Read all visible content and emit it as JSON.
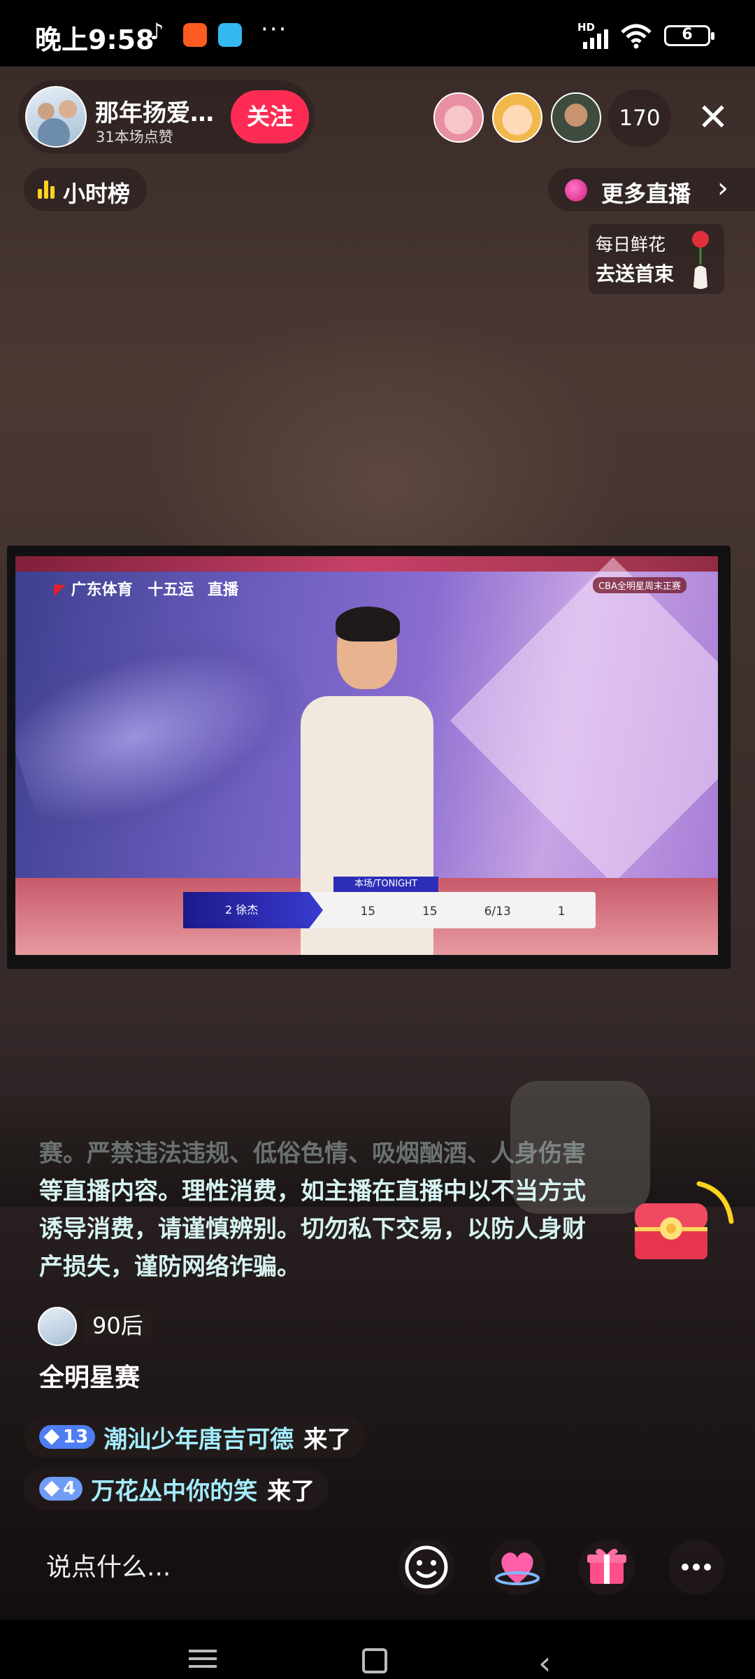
{
  "status_bar": {
    "time": "晚上9:58",
    "more": "···",
    "hd": "HD",
    "battery": "6"
  },
  "host": {
    "name": "那年扬爱…",
    "likes": "31本场点赞",
    "follow_label": "关注"
  },
  "viewers": {
    "count": "170"
  },
  "close_label": "✕",
  "hour_rank_label": "小时榜",
  "more_live_label": "更多直播",
  "flower_card": {
    "line1": "每日鲜花",
    "line2": "去送首束"
  },
  "tv": {
    "channel": "广东体育",
    "event": "十五运",
    "live": "直播",
    "tag": "CBA全明星周末正赛",
    "player": "2 徐杰",
    "score_title": "本场/TONIGHT",
    "stats": [
      "15",
      "15",
      "6/13",
      "1"
    ]
  },
  "notice": {
    "line0": "赛。严禁违法违规、低俗色情、吸烟酗酒、人身伤害",
    "line1": "等直播内容。理性消费，如主播在直播中以不当方式",
    "line2": "诱导消费，请谨慎辨别。切勿私下交易，以防人身财",
    "line3": "产损失，谨防网络诈骗。"
  },
  "message": {
    "badge": "90后",
    "text": "全明星赛"
  },
  "joins": [
    {
      "level": "13",
      "user": "潮汕少年唐吉可德",
      "action": "来了"
    },
    {
      "level": "4",
      "user": "万花丛中你的笑",
      "action": "来了"
    }
  ],
  "input": {
    "placeholder": "说点什么..."
  },
  "colors": {
    "follow": "#fe2c55",
    "username": "#a4ecff",
    "notice": "#d6f3f1",
    "rank_icon": "#ffd21f"
  }
}
